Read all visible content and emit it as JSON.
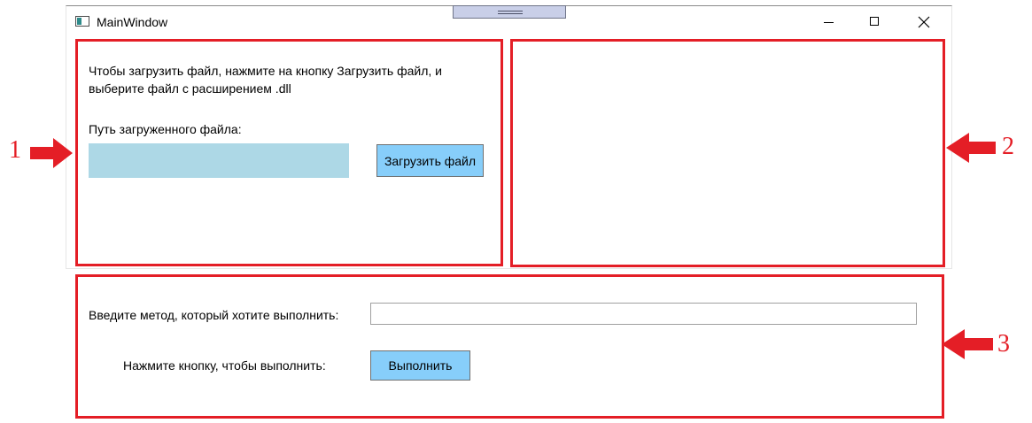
{
  "window": {
    "title": "MainWindow",
    "controls": {
      "minimize_icon": "minimize-icon",
      "maximize_icon": "maximize-icon",
      "close_icon": "close-icon"
    }
  },
  "panel_load": {
    "instructions": "Чтобы загрузить файл, нажмите на кнопку Загрузить файл, и выберите файл с расширением .dll",
    "path_label": "Путь загруженного файла:",
    "path_value": "",
    "upload_button": "Загрузить файл"
  },
  "panel_execute": {
    "method_label": "Введите метод, который хотите выполнить:",
    "method_value": "",
    "run_label": "Нажмите кнопку, чтобы выполнить:",
    "run_button": "Выполнить"
  },
  "annotations": {
    "label_1": "1",
    "label_2": "2",
    "label_3": "3",
    "color": "#e41e26"
  },
  "colors": {
    "button_bg": "#87cefa",
    "path_field_bg": "#add8e6"
  }
}
